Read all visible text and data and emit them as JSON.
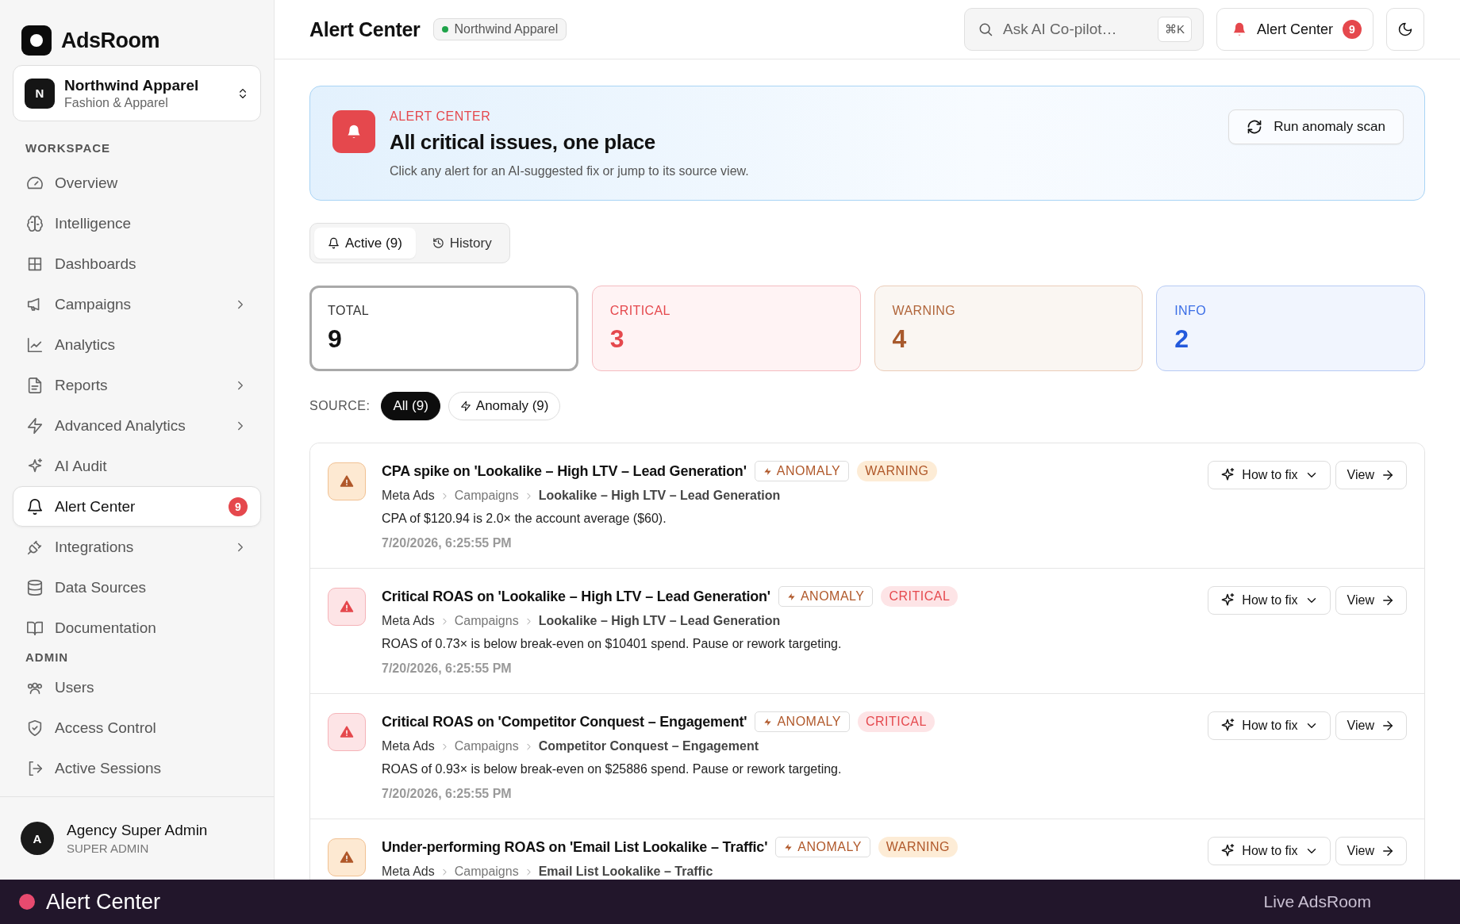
{
  "app": {
    "name": "AdsRoom"
  },
  "org_switcher": {
    "initial": "N",
    "name": "Northwind Apparel",
    "subtitle": "Fashion & Apparel"
  },
  "sidebar": {
    "sections": [
      {
        "title": "WORKSPACE",
        "items": [
          {
            "label": "Overview",
            "expandable": false,
            "selected": false
          },
          {
            "label": "Intelligence",
            "expandable": false,
            "selected": false
          },
          {
            "label": "Dashboards",
            "expandable": false,
            "selected": false
          },
          {
            "label": "Campaigns",
            "expandable": true,
            "selected": false
          },
          {
            "label": "Analytics",
            "expandable": false,
            "selected": false
          },
          {
            "label": "Reports",
            "expandable": true,
            "selected": false
          },
          {
            "label": "Advanced Analytics",
            "expandable": true,
            "selected": false
          },
          {
            "label": "AI Audit",
            "expandable": false,
            "selected": false
          },
          {
            "label": "Alert Center",
            "expandable": false,
            "selected": true,
            "badge": "9"
          },
          {
            "label": "Integrations",
            "expandable": true,
            "selected": false
          },
          {
            "label": "Data Sources",
            "expandable": false,
            "selected": false
          },
          {
            "label": "Documentation",
            "expandable": false,
            "selected": false
          }
        ]
      },
      {
        "title": "ADMIN",
        "items": [
          {
            "label": "Users",
            "expandable": false,
            "selected": false
          },
          {
            "label": "Access Control",
            "expandable": false,
            "selected": false
          },
          {
            "label": "Active Sessions",
            "expandable": false,
            "selected": false
          }
        ]
      }
    ]
  },
  "user": {
    "initial": "A",
    "name": "Agency Super Admin",
    "role": "SUPER ADMIN"
  },
  "header": {
    "title": "Alert Center",
    "workspace_chip": "Northwind Apparel",
    "search": {
      "placeholder": "Ask AI Co-pilot…",
      "shortcut": "⌘K"
    },
    "alerts_button": {
      "label": "Alert Center",
      "badge": "9"
    }
  },
  "banner": {
    "eyebrow": "ALERT CENTER",
    "title": "All critical issues, one place",
    "subtitle": "Click any alert for an AI-suggested fix or jump to its source view.",
    "action": "Run anomaly scan"
  },
  "tabs": [
    {
      "label": "Active (9)",
      "selected": true
    },
    {
      "label": "History",
      "selected": false
    }
  ],
  "stats": [
    {
      "kind": "total",
      "label": "TOTAL",
      "value": "9",
      "selected": true
    },
    {
      "kind": "critical",
      "label": "CRITICAL",
      "value": "3",
      "selected": false
    },
    {
      "kind": "warning",
      "label": "WARNING",
      "value": "4",
      "selected": false
    },
    {
      "kind": "info",
      "label": "INFO",
      "value": "2",
      "selected": false
    }
  ],
  "source_filter": {
    "label": "SOURCE:",
    "options": [
      {
        "label": "All (9)",
        "selected": true
      },
      {
        "label": "Anomaly (9)",
        "selected": false
      }
    ]
  },
  "alerts": [
    {
      "kind": "warning",
      "title": "CPA spike on 'Lookalike – High LTV – Lead Generation'",
      "source": "ANOMALY",
      "severity_label": "WARNING",
      "breadcrumb": [
        "Meta Ads",
        "Campaigns",
        "Lookalike – High LTV – Lead Generation"
      ],
      "message": "CPA of $120.94 is 2.0× the account average ($60).",
      "time": "7/20/2026, 6:25:55 PM",
      "fix": "How to fix",
      "view": "View"
    },
    {
      "kind": "critical",
      "title": "Critical ROAS on 'Lookalike – High LTV – Lead Generation'",
      "source": "ANOMALY",
      "severity_label": "CRITICAL",
      "breadcrumb": [
        "Meta Ads",
        "Campaigns",
        "Lookalike – High LTV – Lead Generation"
      ],
      "message": "ROAS of 0.73× is below break-even on $10401 spend. Pause or rework targeting.",
      "time": "7/20/2026, 6:25:55 PM",
      "fix": "How to fix",
      "view": "View"
    },
    {
      "kind": "critical",
      "title": "Critical ROAS on 'Competitor Conquest – Engagement'",
      "source": "ANOMALY",
      "severity_label": "CRITICAL",
      "breadcrumb": [
        "Meta Ads",
        "Campaigns",
        "Competitor Conquest – Engagement"
      ],
      "message": "ROAS of 0.93× is below break-even on $25886 spend. Pause or rework targeting.",
      "time": "7/20/2026, 6:25:55 PM",
      "fix": "How to fix",
      "view": "View"
    },
    {
      "kind": "warning",
      "title": "Under-performing ROAS on 'Email List Lookalike – Traffic'",
      "source": "ANOMALY",
      "severity_label": "WARNING",
      "breadcrumb": [
        "Meta Ads",
        "Campaigns",
        "Email List Lookalike – Traffic"
      ],
      "fix": "How to fix",
      "view": "View"
    }
  ],
  "status_bar": {
    "title": "Alert Center",
    "right": "Live AdsRoom"
  }
}
